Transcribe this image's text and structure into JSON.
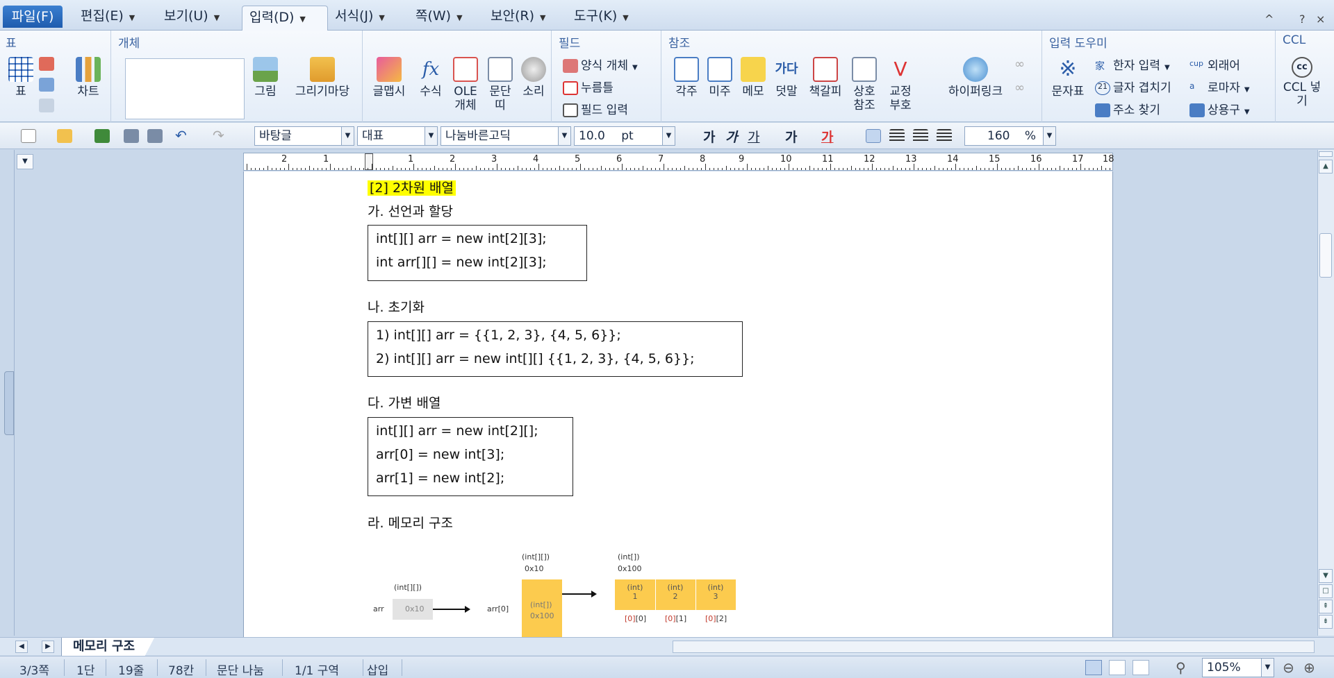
{
  "menubar": {
    "items": [
      "파일(F)",
      "편집(E)",
      "보기(U)",
      "입력(D)",
      "서식(J)",
      "쪽(W)",
      "보안(R)",
      "도구(K)"
    ],
    "controls": [
      "^",
      "?",
      "×"
    ]
  },
  "ribbon": {
    "groups": {
      "table": "표",
      "object": "개체",
      "field": "필드",
      "reference": "참조",
      "input_helper": "입력 도우미",
      "ccl": "CCL"
    },
    "buttons": {
      "table": "표",
      "chart": "차트",
      "picture": "그림",
      "drawing": "그리기마당",
      "glmap": "글맵시",
      "equation": "수식",
      "ole": "OLE 개체",
      "paragraph": "문단 띠",
      "sound": "소리",
      "form_object": "양식 개체",
      "button": "누름틀",
      "field_input": "필드 입력",
      "footnote": "각주",
      "endnote": "미주",
      "memo": "메모",
      "ruby": "덧말",
      "bookmark": "책갈피",
      "cross_ref": "상호 참조",
      "proof": "교정 부호",
      "hyperlink": "하이퍼링크",
      "charmap": "문자표",
      "hanja": "한자 입력",
      "overlap": "글자 겹치기",
      "address": "주소 찾기",
      "foreign": "외래어",
      "roman": "로마자",
      "phrases": "상용구",
      "ccl_insert": "CCL 넣기"
    }
  },
  "toolbar": {
    "style": "바탕글",
    "font_type": "대표",
    "font": "나눔바른고딕",
    "size": "10.0",
    "size_unit": "pt",
    "line_spacing": "160",
    "line_unit": "%",
    "format": [
      "가",
      "가",
      "가",
      "가",
      "가"
    ]
  },
  "ruler": [
    "2",
    "1",
    "1",
    "2",
    "3",
    "4",
    "5",
    "6",
    "7",
    "8",
    "9",
    "10",
    "11",
    "12",
    "13",
    "14",
    "15",
    "16",
    "17",
    "18"
  ],
  "document": {
    "heading": "[2] 2차원 배열",
    "sec_a": "가. 선언과 할당",
    "code_a": [
      "int[][] arr = new int[2][3];",
      "int arr[][] = new int[2][3];"
    ],
    "sec_b": "나. 초기화",
    "code_b": [
      "1) int[][] arr = {{1, 2, 3}, {4, 5, 6}};",
      "2) int[][] arr = new int[][] {{1, 2, 3}, {4, 5, 6}};"
    ],
    "sec_c": "다. 가변 배열",
    "code_c": [
      "int[][] arr = new int[2][];",
      "arr[0] = new int[3];",
      "arr[1] = new int[2];"
    ],
    "sec_d": "라. 메모리 구조"
  },
  "diagram": {
    "stack_type": "(int[][])",
    "stack_name": "arr",
    "stack_value": "0x10",
    "outer_type": "(int[][])",
    "outer_addr": "0x10",
    "outer_index": "arr[0]",
    "outer_cell_type": "(int[])",
    "outer_cell_value": "0x100",
    "inner_type": "(int[])",
    "inner_addr": "0x100",
    "inner_cells": [
      {
        "type": "(int)",
        "value": "1",
        "index_a": "[0]",
        "index_b": "[0]"
      },
      {
        "type": "(int)",
        "value": "2",
        "index_a": "[0]",
        "index_b": "[1]"
      },
      {
        "type": "(int)",
        "value": "3",
        "index_a": "[0]",
        "index_b": "[2]"
      }
    ]
  },
  "tabbar": {
    "sheet": "메모리 구조"
  },
  "statusbar": {
    "page": "3/3쪽",
    "column": "1단",
    "line": "19줄",
    "char": "78칸",
    "para": "문단 나눔",
    "section": "1/1 구역",
    "mode": "삽입",
    "zoom": "105%"
  },
  "colors": {
    "highlight": "#ffff00",
    "diagram_yellow": "#fccb4e",
    "file_tab": "#2a6bc0"
  }
}
